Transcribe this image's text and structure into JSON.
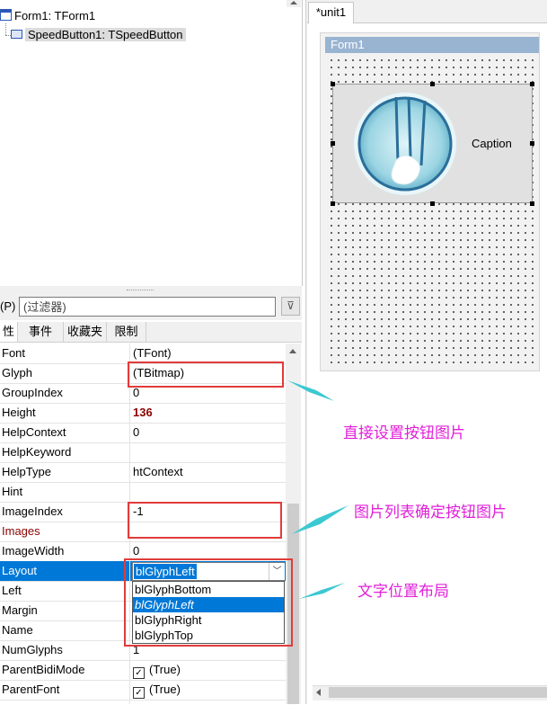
{
  "tree": {
    "items": [
      {
        "label": "Form1: TForm1"
      },
      {
        "label": "SpeedButton1: TSpeedButton"
      }
    ]
  },
  "filter": {
    "label": "(P)",
    "placeholder": "(过滤器)",
    "clear_icon": "filter-clear-icon"
  },
  "tabs": [
    {
      "label": "性"
    },
    {
      "label": "事件"
    },
    {
      "label": "收藏夹"
    },
    {
      "label": "限制"
    }
  ],
  "properties": [
    {
      "name": "Font",
      "value": "(TFont)"
    },
    {
      "name": "Glyph",
      "value": "(TBitmap)"
    },
    {
      "name": "GroupIndex",
      "value": "0"
    },
    {
      "name": "Height",
      "value": "136"
    },
    {
      "name": "HelpContext",
      "value": "0"
    },
    {
      "name": "HelpKeyword",
      "value": ""
    },
    {
      "name": "HelpType",
      "value": "htContext"
    },
    {
      "name": "Hint",
      "value": ""
    },
    {
      "name": "ImageIndex",
      "value": "-1"
    },
    {
      "name": "Images",
      "value": ""
    },
    {
      "name": "ImageWidth",
      "value": "0"
    },
    {
      "name": "Layout",
      "value": ""
    },
    {
      "name": "Left",
      "value": ""
    },
    {
      "name": "Margin",
      "value": ""
    },
    {
      "name": "Name",
      "value": ""
    },
    {
      "name": "NumGlyphs",
      "value": "1"
    },
    {
      "name": "ParentBidiMode",
      "value": "(True)"
    },
    {
      "name": "ParentFont",
      "value": "(True)"
    }
  ],
  "layout_combo": {
    "selected": "blGlyphLeft",
    "options": [
      "blGlyphBottom",
      "blGlyphLeft",
      "blGlyphRight",
      "blGlyphTop"
    ],
    "highlighted_index": 1
  },
  "editor": {
    "tab_label": "*unit1",
    "form_caption": "Form1",
    "button_caption": "Caption"
  },
  "annotations": {
    "glyph_note": "直接设置按钮图片",
    "images_note": "图片列表确定按钮图片",
    "layout_note": "文字位置布局"
  },
  "colors": {
    "accent": "#0078d7",
    "annotation_text": "#e020d8",
    "annotation_arrow": "#3cc8d2",
    "highlight_box": "#e23b3b",
    "form_caption_bar": "#99b4d1"
  }
}
